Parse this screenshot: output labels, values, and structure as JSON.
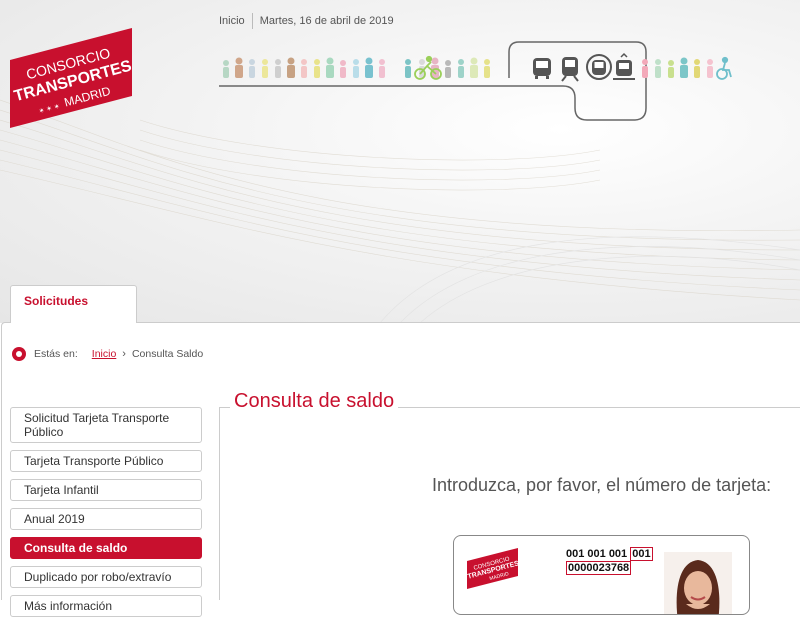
{
  "brand": {
    "line1": "CONSORCIO",
    "line2": "TRANSPORTES",
    "line3": "MADRID",
    "color": "#c8102e"
  },
  "topbar": {
    "home_link": "Inicio",
    "date": "Martes, 16 de abril de 2019"
  },
  "tabs": {
    "solicitudes": "Solicitudes"
  },
  "breadcrumb": {
    "prefix": "Estás en:",
    "home": "Inicio",
    "current": "Consulta Saldo"
  },
  "sidebar": {
    "items": [
      {
        "label": "Solicitud Tarjeta Transporte Público",
        "active": false
      },
      {
        "label": "Tarjeta Transporte Público",
        "active": false
      },
      {
        "label": "Tarjeta Infantil",
        "active": false
      },
      {
        "label": "Anual 2019",
        "active": false
      },
      {
        "label": "Consulta de saldo",
        "active": true
      },
      {
        "label": "Duplicado por robo/extravío",
        "active": false
      },
      {
        "label": "Más información",
        "active": false
      }
    ]
  },
  "main": {
    "title": "Consulta de saldo",
    "prompt": "Introduzca, por favor, el número de tarjeta:"
  },
  "card": {
    "number_prefix": "001 001 001",
    "number_highlight": "001",
    "number_line2": "0000023768"
  },
  "icons": [
    "bus-icon",
    "train-icon",
    "metro-icon",
    "light-rail-icon",
    "bicycle-icon",
    "person-icon",
    "wheelchair-icon"
  ]
}
